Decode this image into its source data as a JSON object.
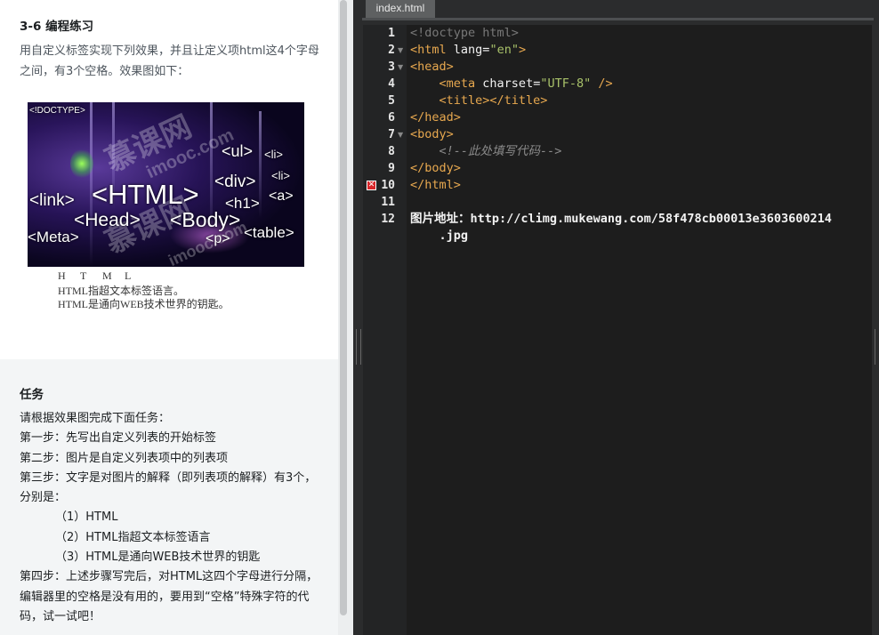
{
  "lesson": {
    "title": "3-6 编程练习",
    "description": "用自定义标签实现下列效果，并且让定义项html这4个字母之间，有3个空格。效果图如下：",
    "image_tags": [
      "<!DOCTYPE>",
      "<ul>",
      "<li>",
      "<li>",
      "<div>",
      "<link>",
      "<HTML>",
      "<h1>",
      "<a>",
      "<Head>",
      "<Body>",
      "<Meta>",
      "<p>",
      "<table>"
    ],
    "image_watermarks": [
      "慕课网",
      "imooc.com",
      "慕课网",
      "imooc.com"
    ],
    "letters": [
      "H",
      "T",
      "M",
      "L"
    ],
    "captions": [
      "HTML指超文本标签语言。",
      "HTML是通向WEB技术世界的钥匙。"
    ]
  },
  "task": {
    "heading": "任务",
    "lines": [
      {
        "text": "请根据效果图完成下面任务：",
        "indent": false
      },
      {
        "text": "第一步：先写出自定义列表的开始标签",
        "indent": false
      },
      {
        "text": "第二步：图片是自定义列表项中的列表项",
        "indent": false
      },
      {
        "text": "第三步：文字是对图片的解释（即列表项的解释）有3个，分别是：",
        "indent": false
      },
      {
        "text": "（1）HTML",
        "indent": true
      },
      {
        "text": "（2）HTML指超文本标签语言",
        "indent": true
      },
      {
        "text": "（3）HTML是通向WEB技术世界的钥匙",
        "indent": true
      },
      {
        "text": "第四步：上述步骤写完后，对HTML这四个字母进行分隔，编辑器里的空格是没有用的，要用到“空格”特殊字符的代码，试一试吧！",
        "indent": false
      }
    ]
  },
  "editor": {
    "tab_label": "index.html",
    "line_numbers": [
      "1",
      "2",
      "3",
      "4",
      "5",
      "6",
      "7",
      "8",
      "9",
      "10",
      "11",
      "12"
    ],
    "error_line": "10",
    "code": {
      "l1": "<!doctype html>",
      "l2_open": "<html ",
      "l2_attr": "lang",
      "l2_eq": "=",
      "l2_val": "\"en\"",
      "l2_close": ">",
      "l3": "<head>",
      "l4_indent": "    ",
      "l4_open": "<meta ",
      "l4_attr": "charset",
      "l4_eq": "=",
      "l4_val": "\"UTF-8\"",
      "l4_close": " />",
      "l5_indent": "    ",
      "l5": "<title></title>",
      "l6": "</head>",
      "l7": "<body>",
      "l8_indent": "    ",
      "l8": "<!--此处填写代码-->",
      "l9": "</body>",
      "l10": "</html>",
      "l12a": "图片地址：http://climg.mukewang.com/58f478cb00013e3603600214",
      "l12b": "    .jpg"
    }
  },
  "colors": {
    "tag": "#e7a84f",
    "string": "#a9c26a",
    "comment": "#787878",
    "error_marker": "#d8262a",
    "editor_bg": "#1d1d1d",
    "task_bg": "#f3f5f6"
  }
}
